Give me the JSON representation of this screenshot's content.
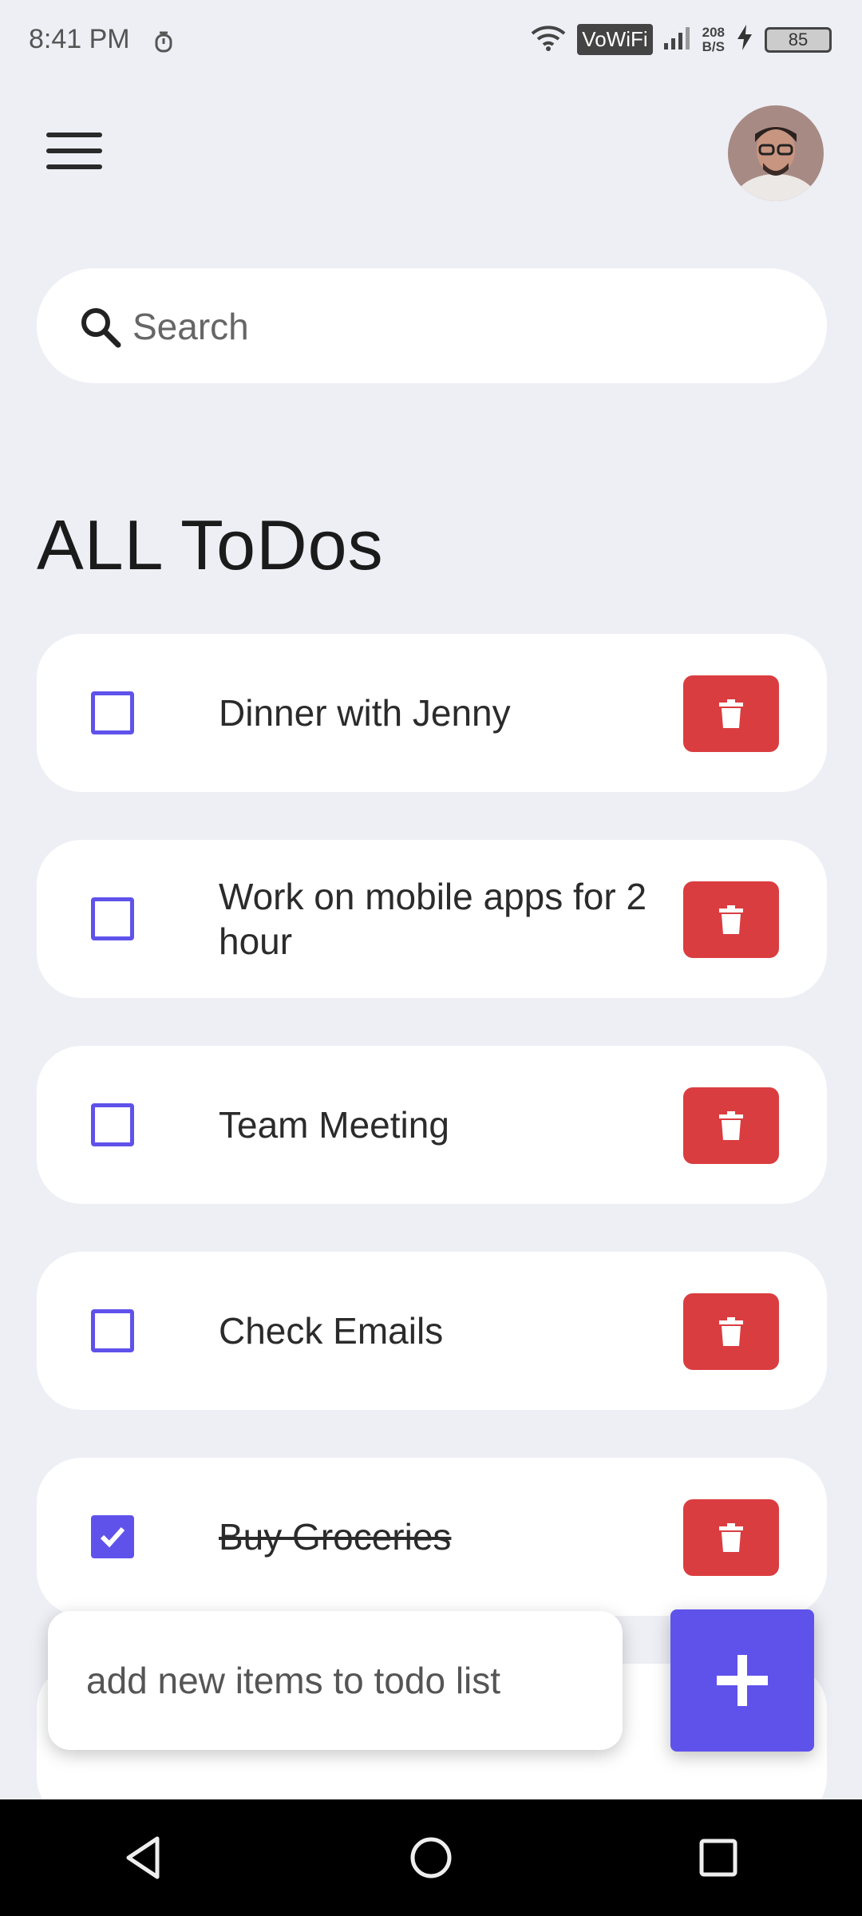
{
  "status_bar": {
    "time": "8:41 PM",
    "vowifi": "VoWiFi",
    "net_speed_value": "208",
    "net_speed_unit": "B/S",
    "battery": "85"
  },
  "search": {
    "placeholder": "Search",
    "value": ""
  },
  "title": "ALL ToDos",
  "todos": [
    {
      "text": "Dinner with Jenny",
      "done": false
    },
    {
      "text": "Work on mobile apps for 2 hour",
      "done": false
    },
    {
      "text": "Team Meeting",
      "done": false
    },
    {
      "text": "Check Emails",
      "done": false
    },
    {
      "text": "Buy Groceries",
      "done": true
    }
  ],
  "add_todo": {
    "placeholder": "add new items to todo list",
    "value": ""
  },
  "colors": {
    "accent": "#5F52EB",
    "delete": "#DA3D40",
    "background": "#EEEFF5"
  },
  "icons": {
    "menu": "hamburger-menu-icon",
    "search": "search-icon",
    "delete": "trash-icon",
    "add": "plus-icon",
    "nav_back": "triangle-back-icon",
    "nav_home": "circle-home-icon",
    "nav_recents": "square-recents-icon"
  }
}
